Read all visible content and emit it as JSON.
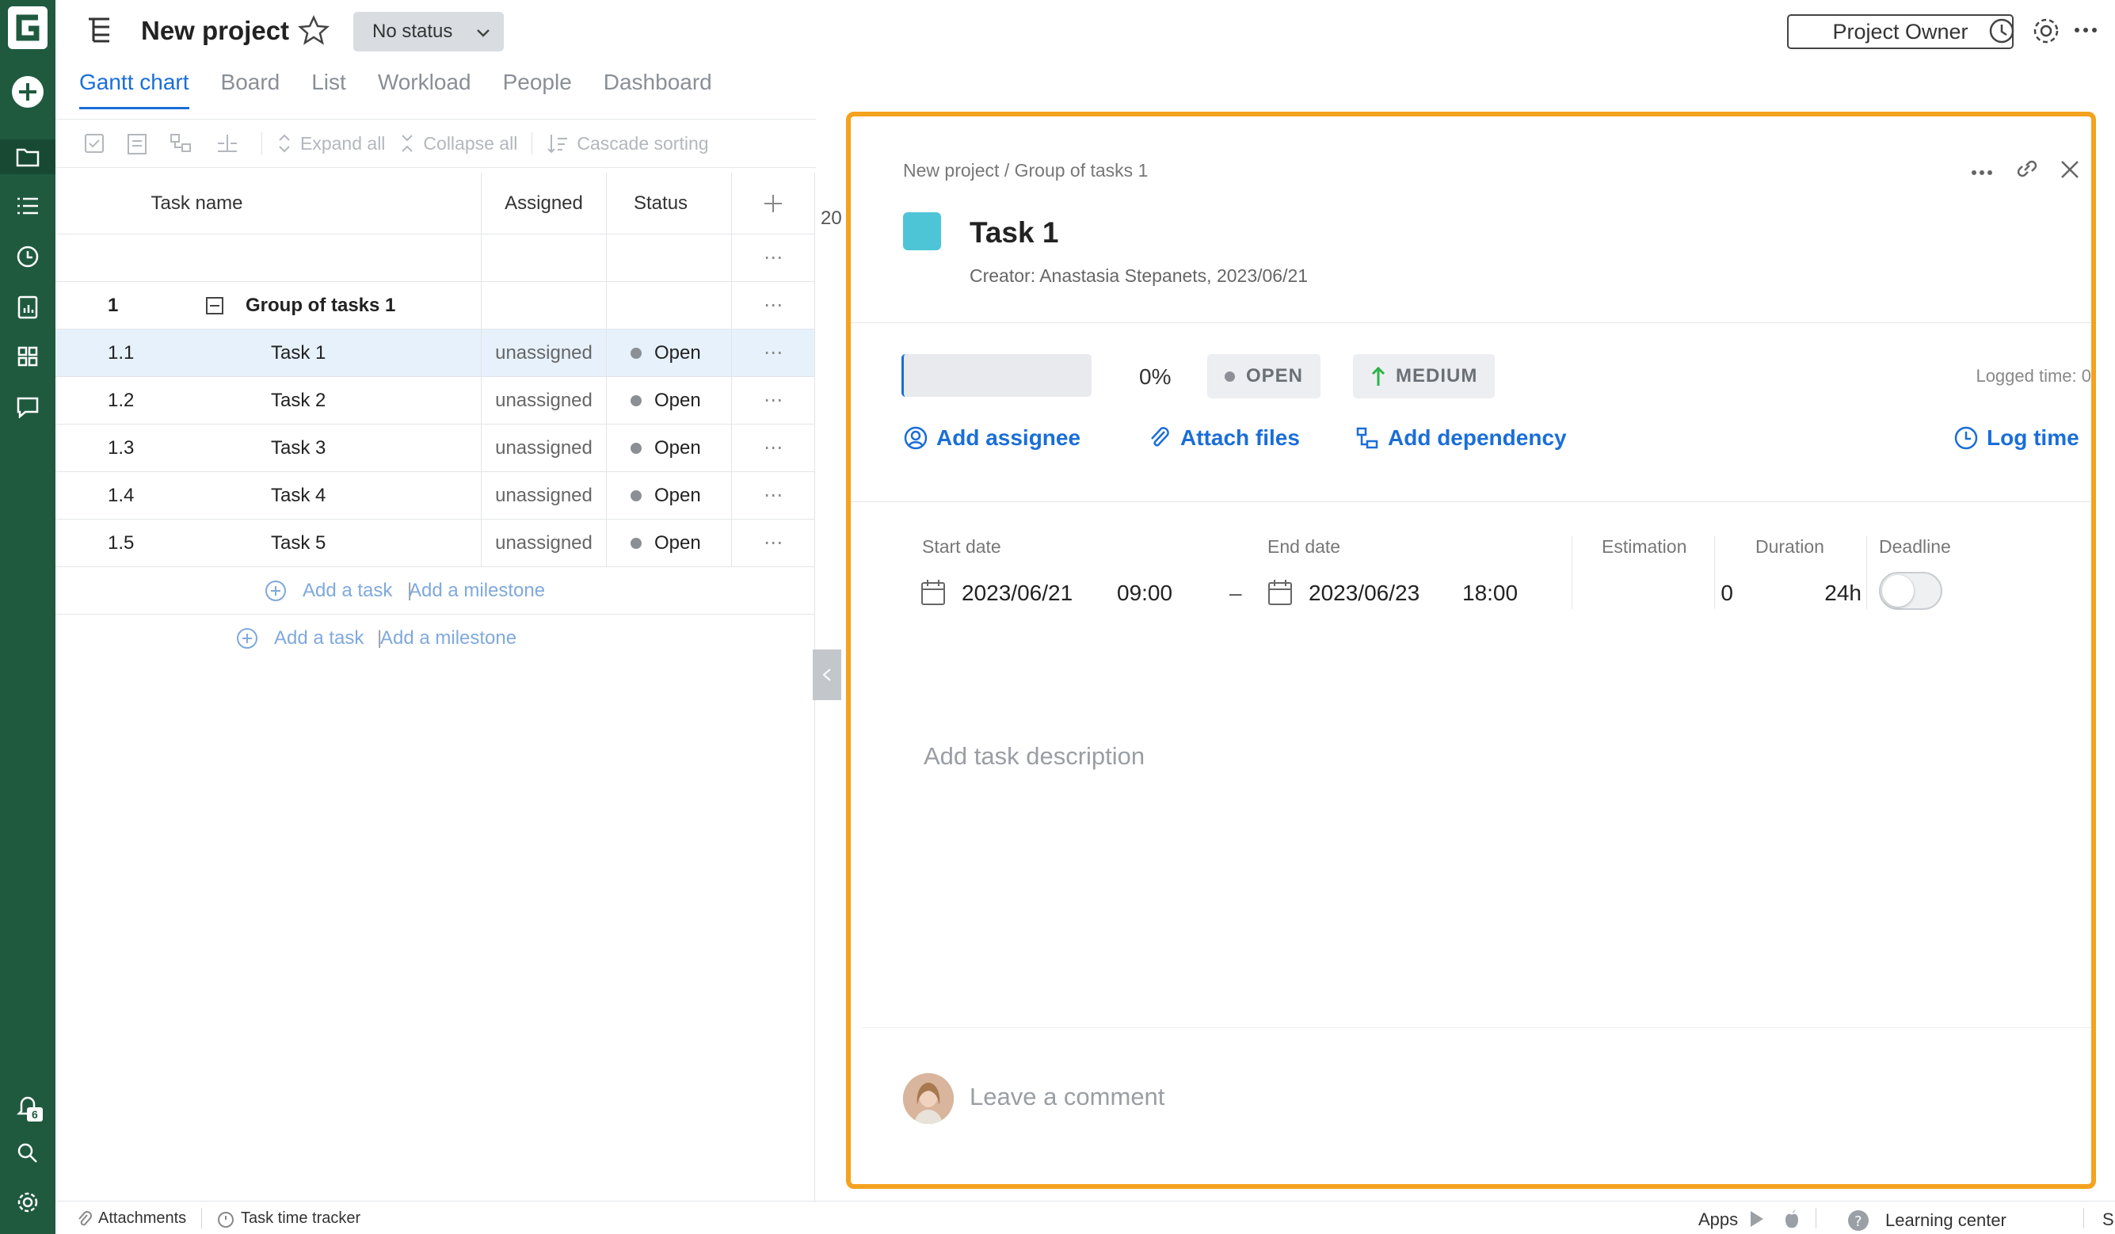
{
  "app": {
    "logo_letter": "G"
  },
  "header": {
    "project_title": "New project",
    "status_dropdown": "No status",
    "role_button": "Project Owner"
  },
  "tabs": [
    "Gantt chart",
    "Board",
    "List",
    "Workload",
    "People",
    "Dashboard"
  ],
  "toolbar": {
    "expand_all": "Expand all",
    "collapse_all": "Collapse all",
    "cascade_sorting": "Cascade sorting"
  },
  "grid": {
    "columns": {
      "task_name": "Task name",
      "assigned": "Assigned",
      "status": "Status"
    },
    "group": {
      "num": "1",
      "name": "Group of tasks 1"
    },
    "tasks": [
      {
        "num": "1.1",
        "name": "Task 1",
        "assigned": "unassigned",
        "status": "Open"
      },
      {
        "num": "1.2",
        "name": "Task 2",
        "assigned": "unassigned",
        "status": "Open"
      },
      {
        "num": "1.3",
        "name": "Task 3",
        "assigned": "unassigned",
        "status": "Open"
      },
      {
        "num": "1.4",
        "name": "Task 4",
        "assigned": "unassigned",
        "status": "Open"
      },
      {
        "num": "1.5",
        "name": "Task 5",
        "assigned": "unassigned",
        "status": "Open"
      }
    ],
    "add_task": "Add a task",
    "add_milestone": "Add a milestone",
    "year_label": "20"
  },
  "footer": {
    "attachments": "Attachments",
    "time_tracker": "Task time tracker",
    "apps": "Apps",
    "learning_center": "Learning center",
    "support": "Support"
  },
  "notifications_count": "6",
  "task_panel": {
    "breadcrumb": "New project / Group of tasks 1",
    "title": "Task 1",
    "color": "#4dc5d6",
    "creator": "Creator: Anastasia Stepanets, 2023/06/21",
    "progress": "0%",
    "status": "OPEN",
    "priority": "MEDIUM",
    "logged_time": "Logged time: 0",
    "actions": {
      "add_assignee": "Add assignee",
      "attach_files": "Attach files",
      "add_dependency": "Add dependency",
      "log_time": "Log time"
    },
    "fields": {
      "start_label": "Start date",
      "start_date": "2023/06/21",
      "start_time": "09:00",
      "end_label": "End date",
      "end_date": "2023/06/23",
      "end_time": "18:00",
      "estimation_label": "Estimation",
      "estimation": "0",
      "duration_label": "Duration",
      "duration": "24h",
      "deadline_label": "Deadline",
      "dash": "–"
    },
    "description_placeholder": "Add task description",
    "comment_placeholder": "Leave a comment"
  },
  "colors": {
    "brand_green": "#1f5a3f",
    "accent_blue": "#1a6ed8",
    "highlight_orange": "#f5a21e"
  }
}
